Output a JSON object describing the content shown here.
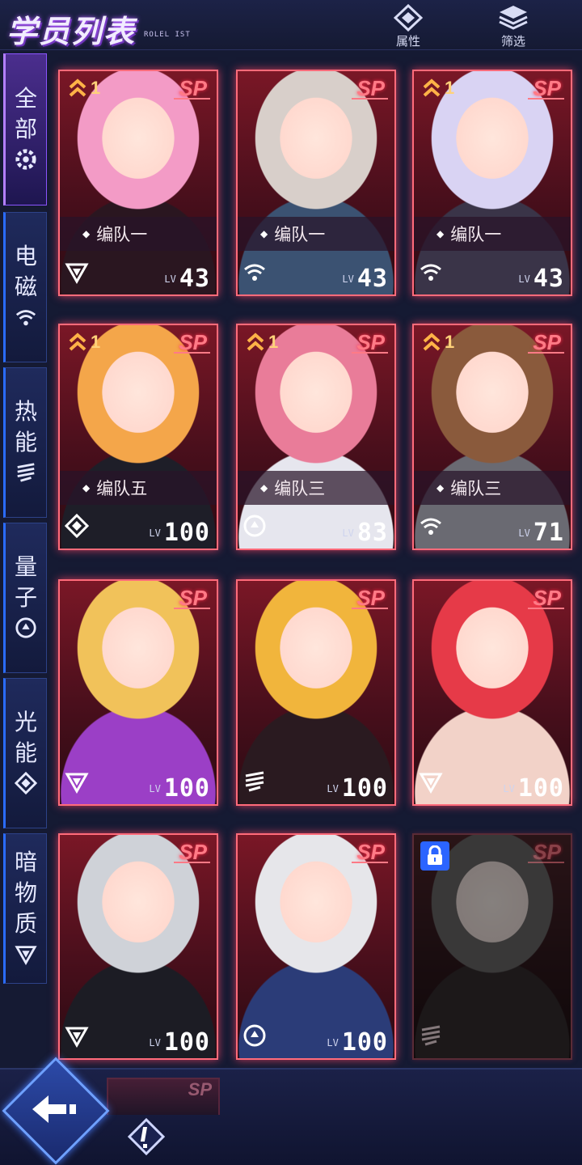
{
  "header": {
    "title": "学员列表",
    "subtitle": "ROLEL IST",
    "buttons": [
      {
        "label": "属性",
        "icon": "attribute-icon"
      },
      {
        "label": "筛选",
        "icon": "filter-layers-icon"
      }
    ]
  },
  "sidebar": {
    "tabs": [
      {
        "chars": [
          "全",
          "部"
        ],
        "icon": "all-gear-icon",
        "active": true
      },
      {
        "chars": [
          "电",
          "磁"
        ],
        "icon": "electromagnetic-wifi-icon",
        "active": false
      },
      {
        "chars": [
          "热",
          "能"
        ],
        "icon": "thermal-stripes-icon",
        "active": false
      },
      {
        "chars": [
          "量",
          "子"
        ],
        "icon": "quantum-ring-icon",
        "active": false
      },
      {
        "chars": [
          "光",
          "能"
        ],
        "icon": "light-diamond-icon",
        "active": false
      },
      {
        "chars": [
          "暗",
          "物",
          "质"
        ],
        "icon": "dark-matter-triangle-icon",
        "active": false
      }
    ]
  },
  "cards": [
    {
      "grade": "SP",
      "rank": "1",
      "team": "编队一",
      "element": "dark",
      "lv_tag": "LV",
      "level": "43",
      "locked": false,
      "palette": [
        "#f39bc6",
        "#2a1620"
      ]
    },
    {
      "grade": "SP",
      "rank": "",
      "team": "编队一",
      "element": "em",
      "lv_tag": "LV",
      "level": "43",
      "locked": false,
      "palette": [
        "#d8cfca",
        "#3b5272"
      ]
    },
    {
      "grade": "SP",
      "rank": "1",
      "team": "编队一",
      "element": "em",
      "lv_tag": "LV",
      "level": "43",
      "locked": false,
      "palette": [
        "#d9d3f3",
        "#3a3448"
      ]
    },
    {
      "grade": "SP",
      "rank": "1",
      "team": "编队五",
      "element": "light",
      "lv_tag": "LV",
      "level": "100",
      "locked": false,
      "palette": [
        "#f4a64a",
        "#1e1e28"
      ]
    },
    {
      "grade": "SP",
      "rank": "1",
      "team": "编队三",
      "element": "quantum",
      "lv_tag": "LV",
      "level": "83",
      "locked": false,
      "palette": [
        "#e97c99",
        "#e6e6ee"
      ]
    },
    {
      "grade": "SP",
      "rank": "1",
      "team": "编队三",
      "element": "em",
      "lv_tag": "LV",
      "level": "71",
      "locked": false,
      "palette": [
        "#8a5a3c",
        "#6a6a72"
      ]
    },
    {
      "grade": "SP",
      "rank": "",
      "team": "",
      "element": "dark",
      "lv_tag": "LV",
      "level": "100",
      "locked": false,
      "palette": [
        "#f1c25a",
        "#9b3fc6"
      ]
    },
    {
      "grade": "SP",
      "rank": "",
      "team": "",
      "element": "thermal",
      "lv_tag": "LV",
      "level": "100",
      "locked": false,
      "palette": [
        "#f1b53c",
        "#2a1a20"
      ]
    },
    {
      "grade": "SP",
      "rank": "",
      "team": "",
      "element": "dark",
      "lv_tag": "LV",
      "level": "100",
      "locked": false,
      "palette": [
        "#e63a48",
        "#f2d2c8"
      ]
    },
    {
      "grade": "SP",
      "rank": "",
      "team": "",
      "element": "dark",
      "lv_tag": "LV",
      "level": "100",
      "locked": false,
      "palette": [
        "#cfd2d8",
        "#1c1c24"
      ]
    },
    {
      "grade": "SP",
      "rank": "",
      "team": "",
      "element": "quantum",
      "lv_tag": "LV",
      "level": "100",
      "locked": false,
      "palette": [
        "#e6e6ea",
        "#2b3c78"
      ]
    },
    {
      "grade": "SP",
      "rank": "",
      "team": "",
      "element": "thermal",
      "lv_tag": "",
      "level": "",
      "locked": true,
      "palette": [
        "#6b6468",
        "#3a2a2e"
      ]
    }
  ],
  "peek_card": {
    "grade": "SP"
  },
  "bottom": {
    "back_icon": "back-arrow-icon",
    "info_icon": "exclamation-info-icon"
  },
  "colors": {
    "card_border": "#ff6b7a",
    "sp": "#ff7a86",
    "accent": "#2a6cff",
    "active_tab": "#8a55ff"
  }
}
